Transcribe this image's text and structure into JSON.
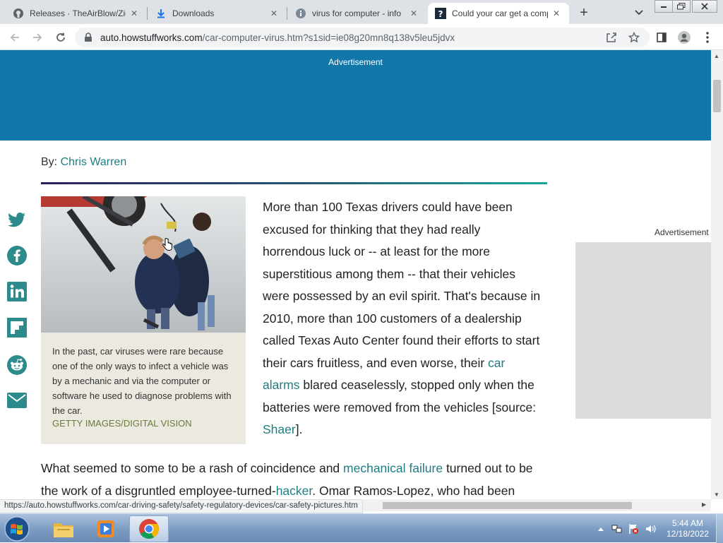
{
  "browser": {
    "tabs": [
      {
        "title": "Releases · TheAirBlow/Zig",
        "icon": "github-icon",
        "active": false
      },
      {
        "title": "Downloads",
        "icon": "download-icon",
        "active": false
      },
      {
        "title": "virus for computer - info",
        "icon": "info-icon",
        "active": false
      },
      {
        "title": "Could your car get a comp",
        "icon": "howstuffworks-icon",
        "active": true
      }
    ],
    "new_tab": "+",
    "url_host": "auto.howstuffworks.com",
    "url_path": "/car-computer-virus.htm?s1sid=ie08g20mn8q138v5leu5jdvx",
    "status_url": "https://auto.howstuffworks.com/car-driving-safety/safety-regulatory-devices/car-safety-pictures.htm"
  },
  "page": {
    "top_ad_label": "Advertisement",
    "byline_prefix": "By:",
    "author": "Chris Warren",
    "side_ad_label": "Advertisement",
    "figure": {
      "caption": "In the past, car viruses were rare because one of the only ways to infect a vehicle was by a mechanic and via the computer or software he used to diagnose problems with the car.",
      "credit": "GETTY IMAGES/DIGITAL VISION"
    },
    "para1": {
      "t1": "More than 100 Texas drivers could have been excused for thinking that they had really horrendous luck or -- at least for the more superstitious among them -- that their vehicles were possessed by an evil spirit. That's because in 2010, more than 100 customers of a dealership called Texas Auto Center found their efforts to start their cars fruitless, and even worse, their ",
      "link1": "car alarms",
      "t2": " blared ceaselessly, stopped only when the batteries were removed from the vehicles [source: ",
      "link2": "Shaer",
      "t3": "]."
    },
    "para2": {
      "t1": "What seemed to some to be a rash of coincidence and ",
      "link1": "mechanical failure",
      "t2": " turned out to be the work of a disgruntled employee-turned-",
      "link2": "hacker",
      "t3": ". Omar Ramos-Lopez, who had been"
    },
    "share_icons": [
      "twitter-icon",
      "facebook-icon",
      "linkedin-icon",
      "flipboard-icon",
      "reddit-icon",
      "email-icon"
    ]
  },
  "taskbar": {
    "time": "5:44 AM",
    "date": "12/18/2022",
    "apps": [
      "file-explorer-icon",
      "media-player-icon",
      "chrome-icon"
    ]
  },
  "colors": {
    "ad_banner": "#1177a9",
    "link": "#1e7d83",
    "credit": "#6a7b3c"
  }
}
